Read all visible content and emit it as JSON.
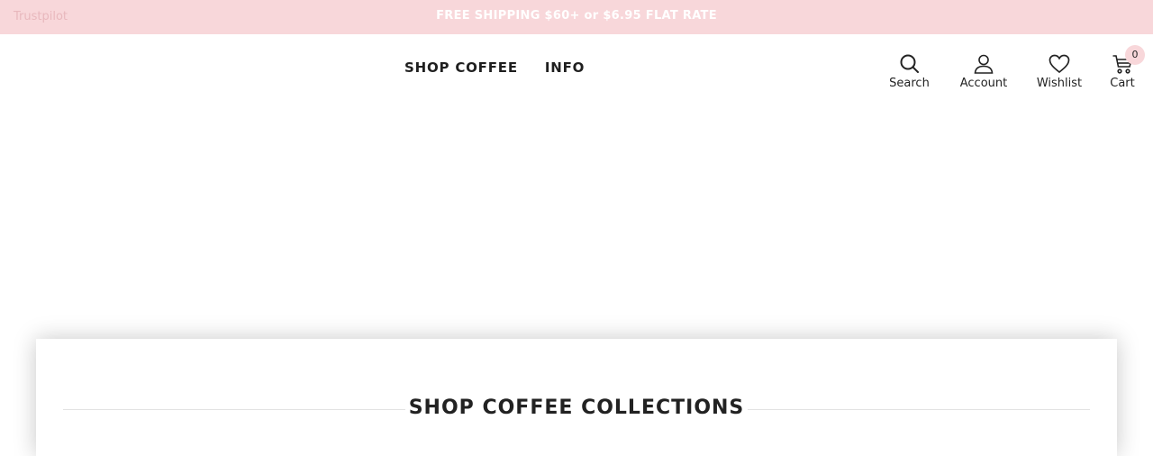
{
  "announcement": {
    "trustpilot_label": "Trustpilot",
    "text": "FREE SHIPPING $60+ or $6.95 FLAT RATE",
    "background_color": "#f8d7da"
  },
  "nav": {
    "items": [
      {
        "label": "SHOP COFFEE"
      },
      {
        "label": "INFO"
      }
    ]
  },
  "tools": {
    "search": {
      "label": "Search",
      "icon": "search-icon"
    },
    "account": {
      "label": "Account",
      "icon": "user-icon"
    },
    "wishlist": {
      "label": "Wishlist",
      "icon": "heart-icon"
    },
    "cart": {
      "label": "Cart",
      "icon": "cart-icon",
      "count": "0"
    }
  },
  "collections": {
    "title": "SHOP COFFEE COLLECTIONS"
  }
}
